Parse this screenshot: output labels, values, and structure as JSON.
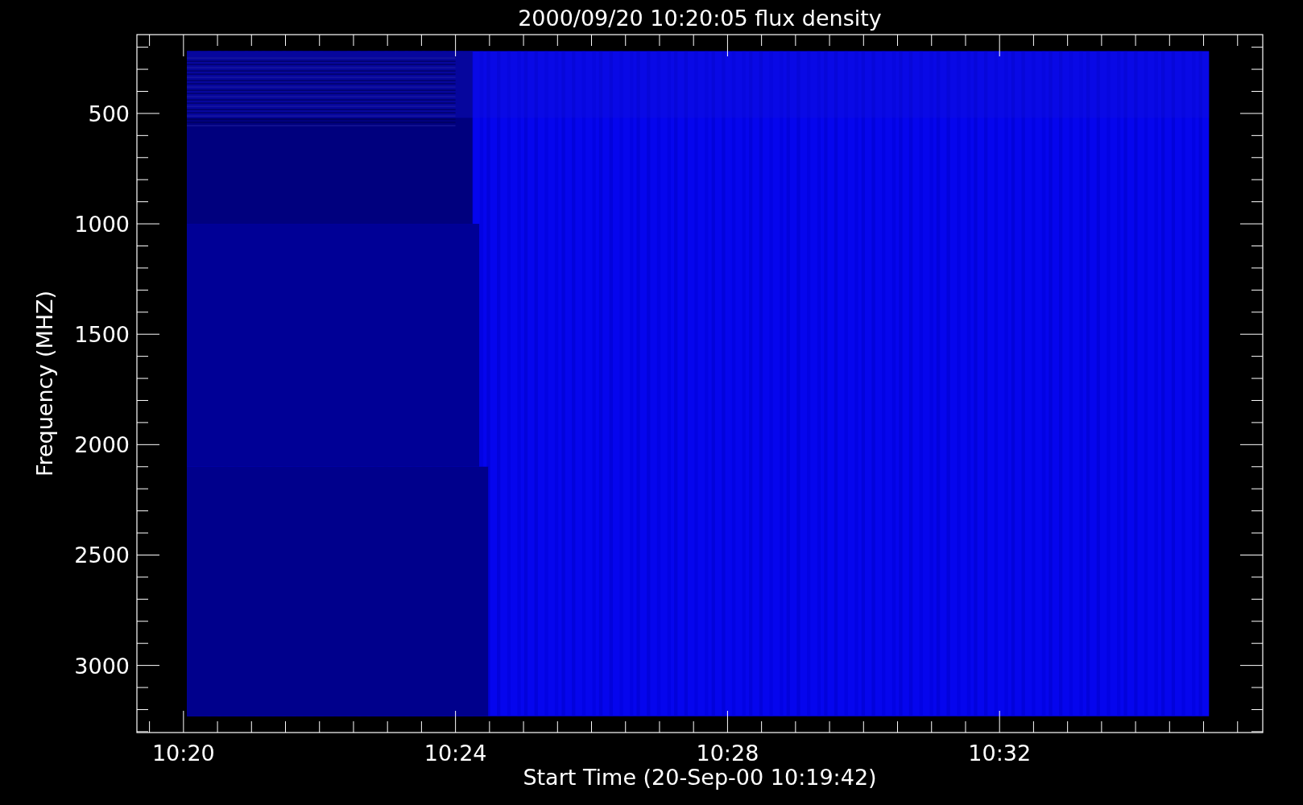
{
  "plot": {
    "title": "2000/09/20 10:20:05 flux density",
    "xlabel": "Start Time (20-Sep-00 10:19:42)",
    "ylabel": "Frequency (MHZ)",
    "xticks": [
      "10:20",
      "10:24",
      "10:28",
      "10:32"
    ],
    "yticks": [
      "500",
      "1000",
      "1500",
      "2000",
      "2500",
      "3000"
    ]
  }
}
